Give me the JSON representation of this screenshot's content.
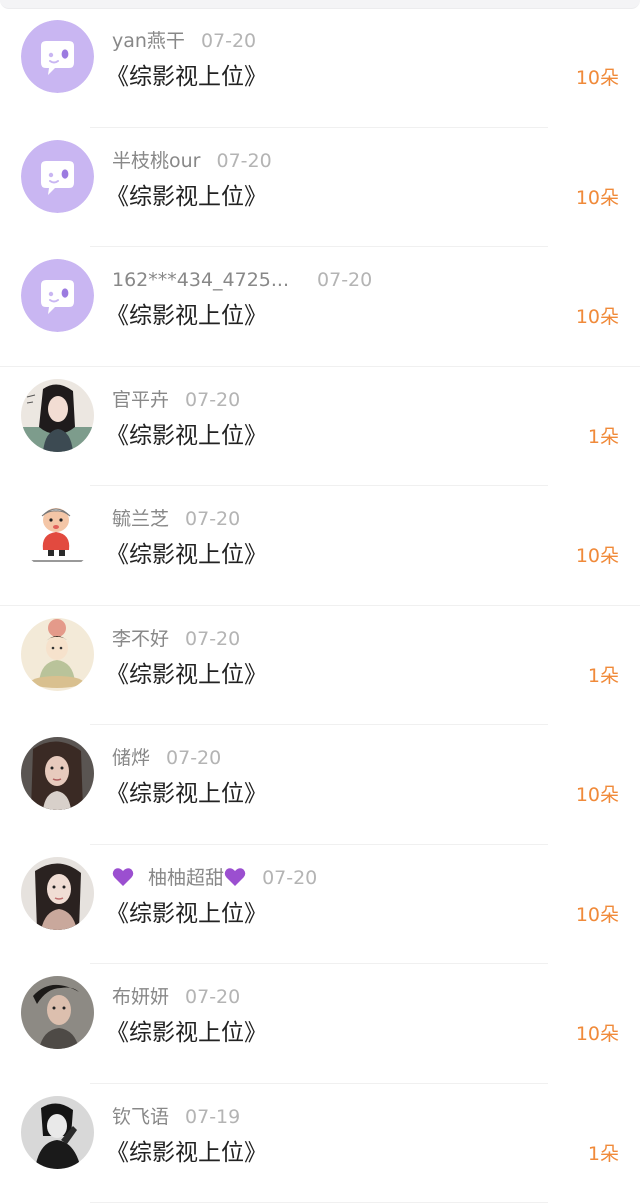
{
  "accent_color": "#f08a3a",
  "items": [
    {
      "name": "yan燕干",
      "date": "07-20",
      "title": "《综影视上位》",
      "count": "10朵",
      "avatar": "chat-bubble-icon"
    },
    {
      "name": "半枝桃our",
      "date": "07-20",
      "title": "《综影视上位》",
      "count": "10朵",
      "avatar": "chat-bubble-icon"
    },
    {
      "name": "162***434_4725...",
      "date": "07-20",
      "title": "《综影视上位》",
      "count": "10朵",
      "avatar": "chat-bubble-icon"
    },
    {
      "name": "官平卉",
      "date": "07-20",
      "title": "《综影视上位》",
      "count": "1朵",
      "avatar": "user-photo"
    },
    {
      "name": "毓兰芝",
      "date": "07-20",
      "title": "《综影视上位》",
      "count": "10朵",
      "avatar": "cartoon-character"
    },
    {
      "name": "李不好",
      "date": "07-20",
      "title": "《综影视上位》",
      "count": "1朵",
      "avatar": "cartoon-character"
    },
    {
      "name": "储烨",
      "date": "07-20",
      "title": "《综影视上位》",
      "count": "10朵",
      "avatar": "user-photo"
    },
    {
      "name": "柚柚超甜",
      "date": "07-20",
      "title": "《综影视上位》",
      "count": "10朵",
      "avatar": "user-photo"
    },
    {
      "name": "布妍妍",
      "date": "07-20",
      "title": "《综影视上位》",
      "count": "10朵",
      "avatar": "user-photo"
    },
    {
      "name": "钦飞语",
      "date": "07-19",
      "title": "《综影视上位》",
      "count": "1朵",
      "avatar": "user-photo"
    }
  ]
}
